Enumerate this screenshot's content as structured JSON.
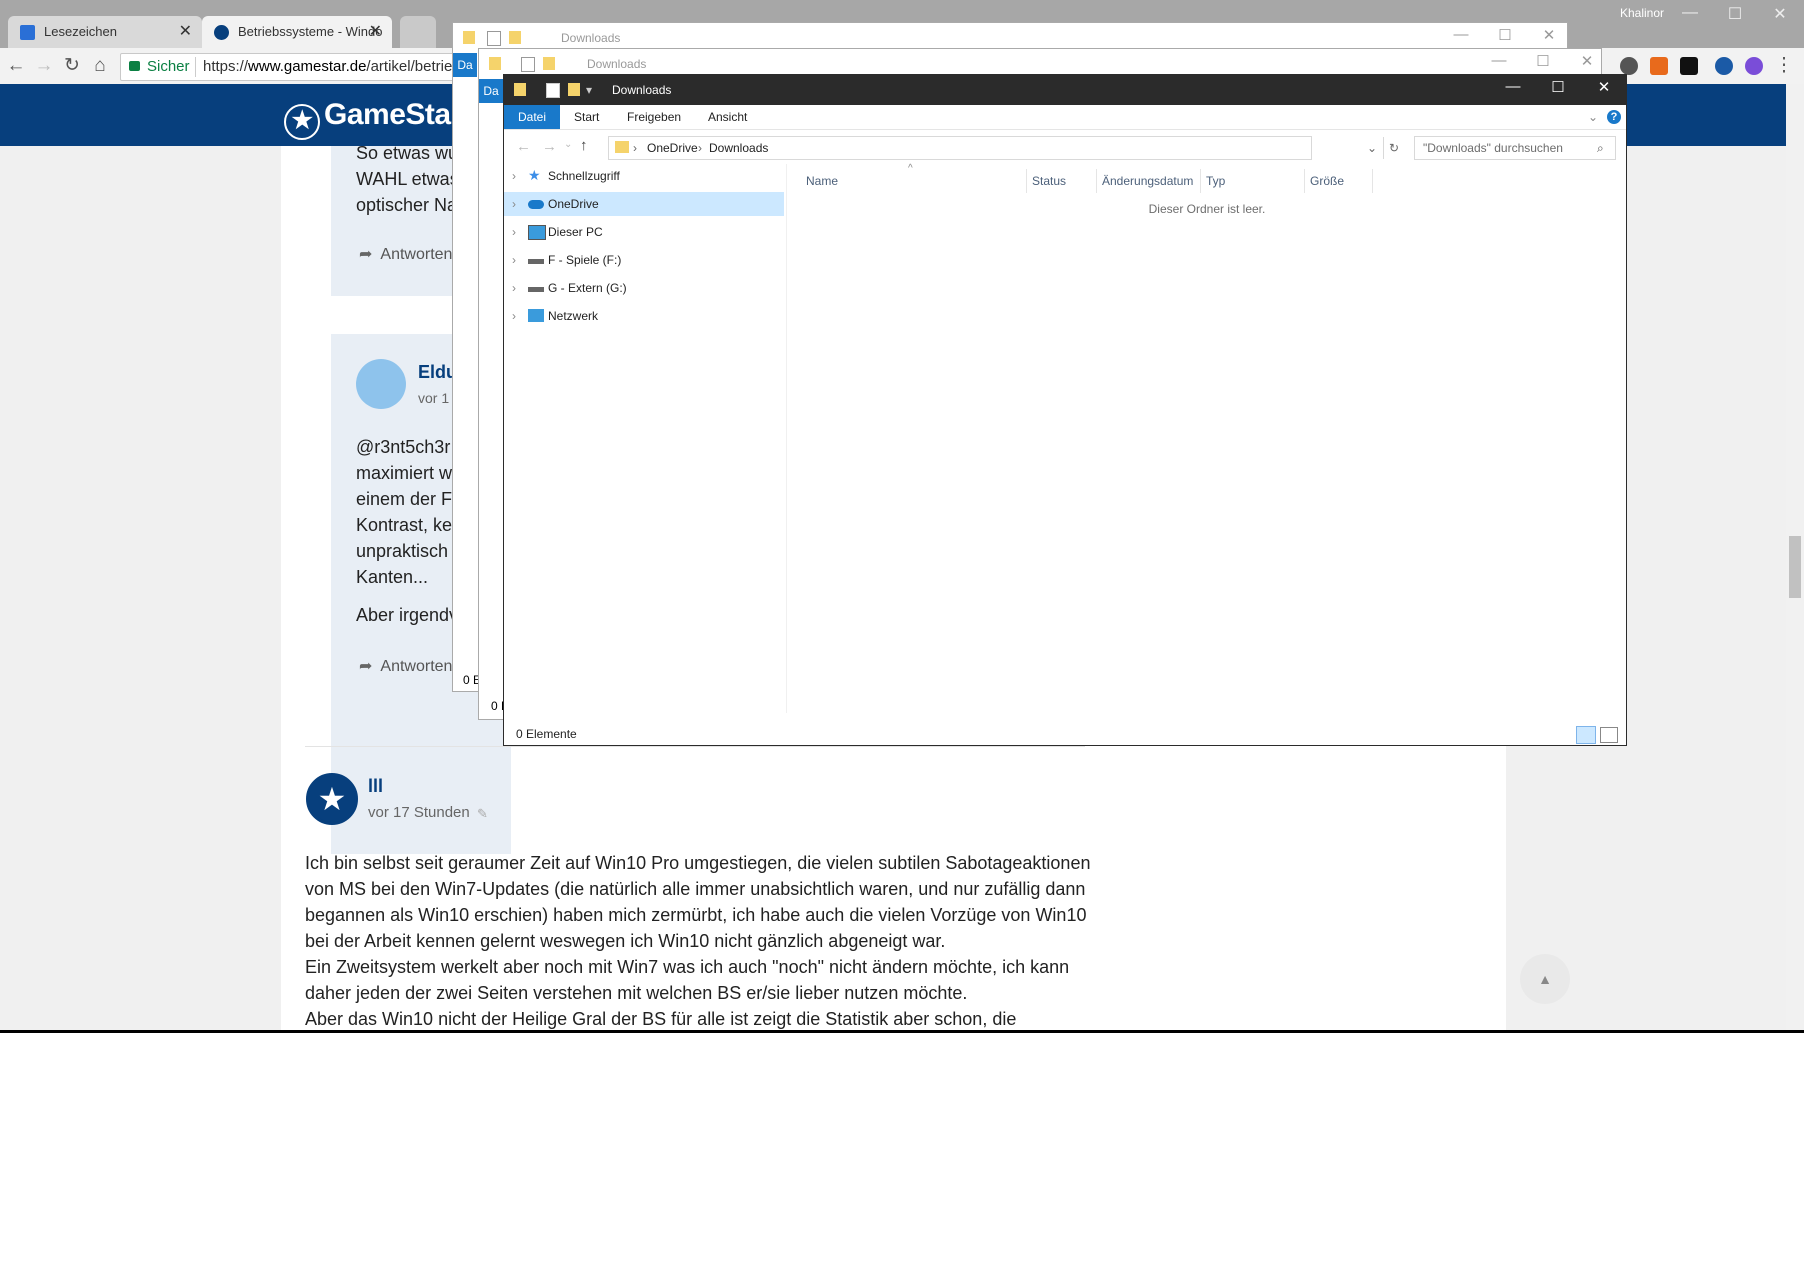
{
  "chrome": {
    "tabs": [
      {
        "label": "Lesezeichen"
      },
      {
        "label": "Betriebssysteme - Windo"
      }
    ],
    "profile": "Khalinor",
    "omnibox": {
      "secure": "Sicher",
      "url_scheme": "https://",
      "url_host": "www.gamestar.de",
      "url_path": "/artikel/betrieb"
    }
  },
  "site": {
    "logo": "GameStar",
    "comment1": {
      "lines": [
        "So etwas wu",
        "WAHL etwas",
        "optischer Na"
      ],
      "answer": "Antworten"
    },
    "comment2": {
      "author": "Eldu",
      "time": "vor 1",
      "lines": [
        "@r3nt5ch3r",
        "maximiert w",
        "einem der Fe",
        "Kontrast, kei",
        "unpraktisch",
        "Kanten..."
      ],
      "line2": "Aber irgendv",
      "answer": "Antworten"
    },
    "comment3": {
      "author": "lll",
      "time": "vor 17 Stunden",
      "lines": [
        "Ich bin selbst seit geraumer Zeit auf Win10 Pro umgestiegen, die vielen subtilen Sabotageaktionen",
        "von MS bei den Win7-Updates (die natürlich alle immer unabsichtlich waren, und nur zufällig dann",
        "begannen als Win10 erschien) haben mich zermürbt, ich habe auch die vielen Vorzüge von Win10",
        "bei der Arbeit kennen gelernt weswegen ich Win10 nicht gänzlich abgeneigt war.",
        "Ein Zweitsystem werkelt aber noch mit Win7 was ich auch \"noch\" nicht ändern möchte, ich kann",
        "daher jeden der zwei Seiten verstehen mit welchen BS er/sie lieber nutzen möchte.",
        "Aber das Win10 nicht der Heilige Gral der BS für alle ist zeigt die Statistik aber schon, die"
      ]
    }
  },
  "explorer": {
    "bg_title_1": "Downloads",
    "bg_title_2": "Downloads",
    "bg_status_1": "0 E",
    "bg_status_2": "0 E",
    "bg_ribbon_tab": "Da",
    "title": "Downloads",
    "ribbon_tabs": [
      "Datei",
      "Start",
      "Freigeben",
      "Ansicht"
    ],
    "breadcrumb": [
      "OneDrive",
      "Downloads"
    ],
    "search_placeholder": "\"Downloads\" durchsuchen",
    "nav": [
      {
        "label": "Schnellzugriff",
        "icon": "star-icon",
        "color": "#3c8ee8"
      },
      {
        "label": "OneDrive",
        "icon": "cloud-icon",
        "color": "#1979ca",
        "selected": true
      },
      {
        "label": "Dieser PC",
        "icon": "monitor-icon",
        "color": "#3a9bdc"
      },
      {
        "label": "F - Spiele (F:)",
        "icon": "drive-icon",
        "color": "#666666"
      },
      {
        "label": "G - Extern (G:)",
        "icon": "drive-icon",
        "color": "#666666"
      },
      {
        "label": "Netzwerk",
        "icon": "network-icon",
        "color": "#3a9bdc"
      }
    ],
    "columns": [
      "Name",
      "Status",
      "Änderungsdatum",
      "Typ",
      "Größe"
    ],
    "empty_text": "Dieser Ordner ist leer.",
    "status_text": "0 Elemente"
  },
  "colors": {
    "site_header": "#073f7d",
    "link": "#073f7d",
    "ribbon_file": "#1979ca"
  }
}
